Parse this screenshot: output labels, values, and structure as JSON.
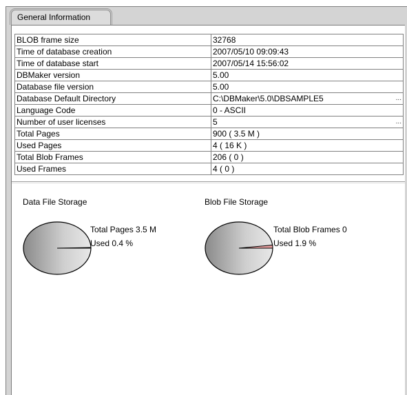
{
  "tab": {
    "label": "General Information"
  },
  "info_rows": [
    {
      "key": "BLOB frame size",
      "value": "32768",
      "ellipsis": ""
    },
    {
      "key": "Time of database creation",
      "value": "2007/05/10 09:09:43",
      "ellipsis": ""
    },
    {
      "key": "Time of database start",
      "value": "2007/05/14 15:56:02",
      "ellipsis": ""
    },
    {
      "key": "DBMaker version",
      "value": "5.00",
      "ellipsis": ""
    },
    {
      "key": "Database file version",
      "value": "5.00",
      "ellipsis": ""
    },
    {
      "key": "Database Default Directory",
      "value": "C:\\DBMaker\\5.0\\DBSAMPLE5",
      "ellipsis": "..."
    },
    {
      "key": "Language Code",
      "value": "0 - ASCII",
      "ellipsis": ""
    },
    {
      "key": "Number of user licenses",
      "value": "5",
      "ellipsis": "..."
    },
    {
      "key": "Total Pages",
      "value": "900 ( 3.5 M )",
      "ellipsis": ""
    },
    {
      "key": "Used Pages",
      "value": "4 ( 16 K )",
      "ellipsis": ""
    },
    {
      "key": "Total Blob Frames",
      "value": "206 ( 0 )",
      "ellipsis": ""
    },
    {
      "key": "Used Frames",
      "value": "4 ( 0 )",
      "ellipsis": ""
    }
  ],
  "chart_data": [
    {
      "type": "pie",
      "title": "Data File Storage",
      "labels": {
        "total": "Total Pages 3.5 M",
        "used": "Used 0.4 %"
      },
      "used_fraction": 0.004,
      "colors": {
        "free": "#b8b8b8",
        "used": "#000000"
      }
    },
    {
      "type": "pie",
      "title": "Blob File Storage",
      "labels": {
        "total": "Total Blob Frames 0",
        "used": "Used 1.9 %"
      },
      "used_fraction": 0.019,
      "colors": {
        "free": "#b8b8b8",
        "used": "#e8a0a0"
      }
    }
  ]
}
